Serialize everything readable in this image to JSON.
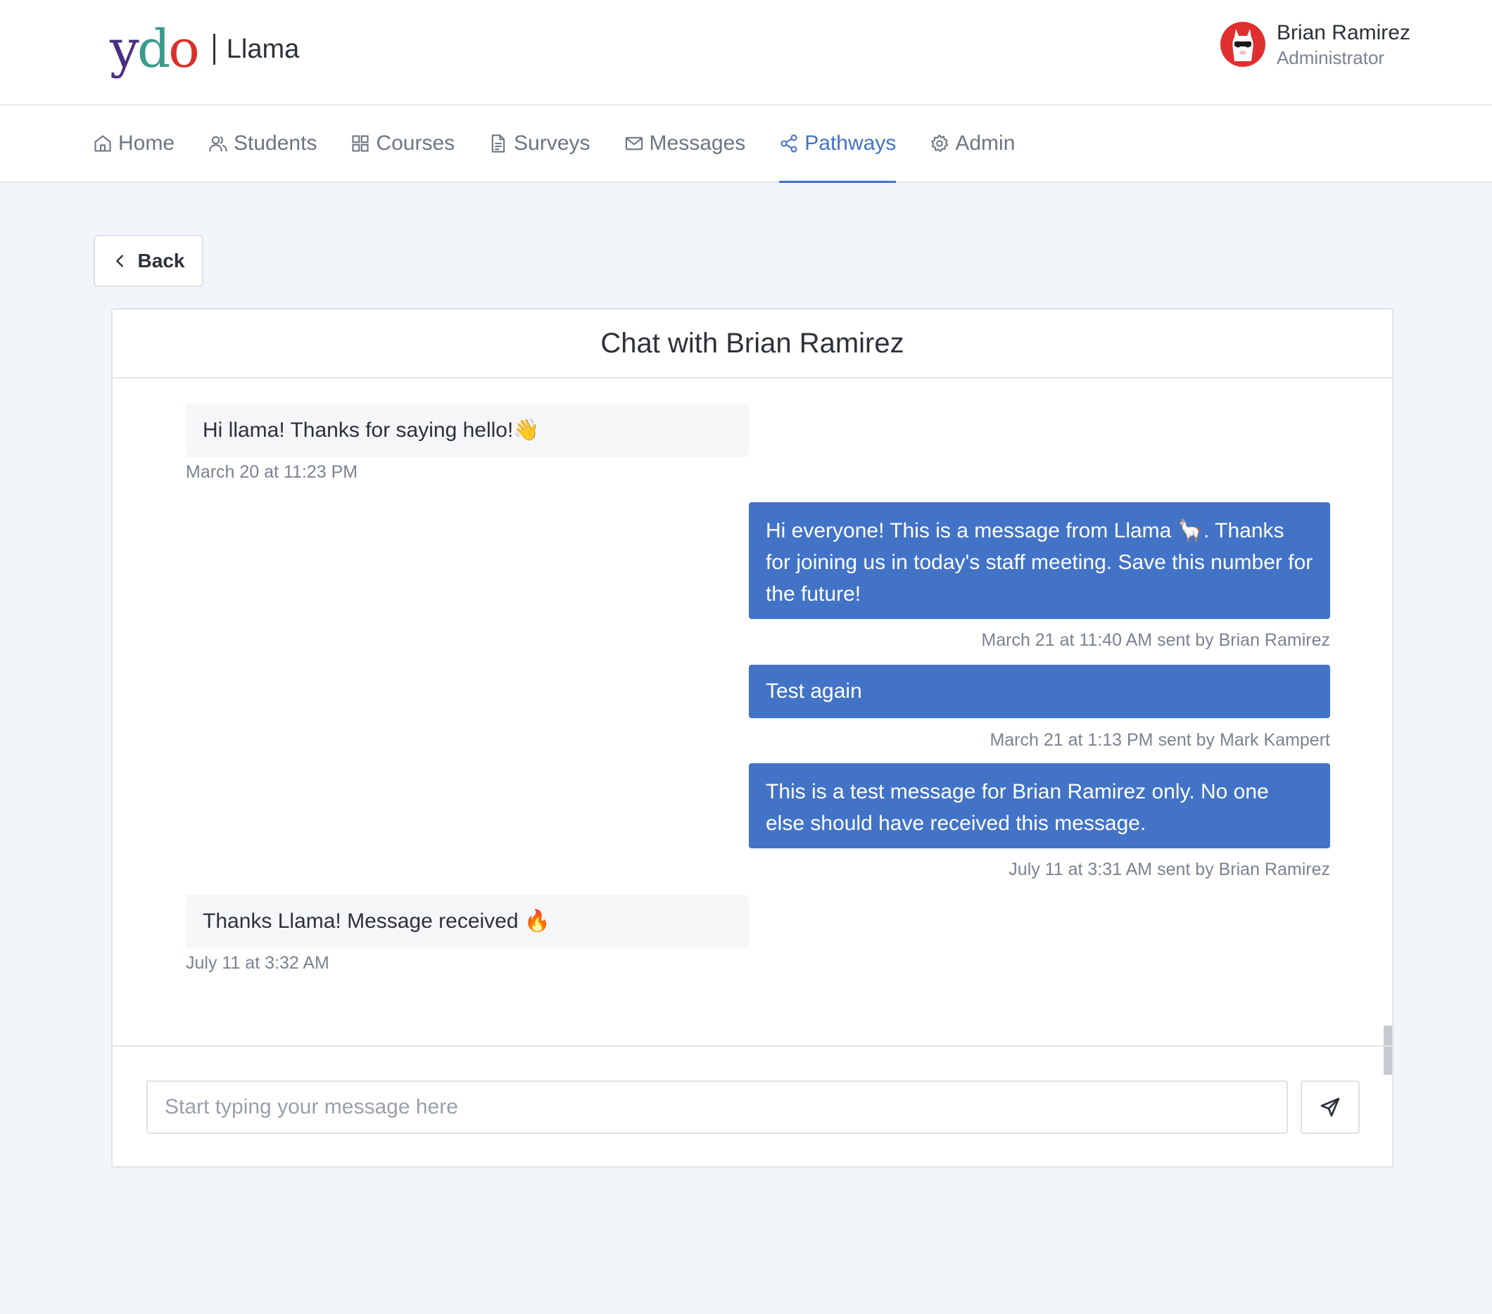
{
  "brand": {
    "logo_y": "y",
    "logo_d": "d",
    "logo_o": "o",
    "app_name": "Llama"
  },
  "user": {
    "name": "Brian Ramirez",
    "role": "Administrator",
    "avatar_color": "#e02f2f"
  },
  "nav": {
    "items": [
      {
        "label": "Home",
        "icon": "home-icon"
      },
      {
        "label": "Students",
        "icon": "users-icon"
      },
      {
        "label": "Courses",
        "icon": "grid-icon"
      },
      {
        "label": "Surveys",
        "icon": "document-icon"
      },
      {
        "label": "Messages",
        "icon": "mail-icon"
      },
      {
        "label": "Pathways",
        "icon": "share-icon",
        "active": true
      },
      {
        "label": "Admin",
        "icon": "gear-icon"
      }
    ],
    "active_color": "#4273c7"
  },
  "back_button": {
    "label": "Back"
  },
  "chat": {
    "title": "Chat with Brian Ramirez",
    "messages": [
      {
        "direction": "in",
        "text": "Hi llama! Thanks for saying hello!👋",
        "meta": "March 20 at 11:23 PM"
      },
      {
        "direction": "out",
        "text": "Hi everyone! This is a message from Llama 🦙. Thanks for joining us in today's staff meeting. Save this number for the future!",
        "meta": "March 21 at 11:40 AM sent by Brian Ramirez"
      },
      {
        "direction": "out",
        "text": "Test again",
        "meta": "March 21 at 1:13 PM sent by Mark Kampert"
      },
      {
        "direction": "out",
        "text": "This is a test message for Brian Ramirez only. No one else should have received this message.",
        "meta": "July 11 at 3:31 AM sent by Brian Ramirez"
      },
      {
        "direction": "in",
        "text": "Thanks Llama! Message received 🔥",
        "meta": "July 11 at 3:32 AM"
      }
    ],
    "input_value": "",
    "input_placeholder": "Start typing your message here",
    "outgoing_color": "#4273c7"
  }
}
